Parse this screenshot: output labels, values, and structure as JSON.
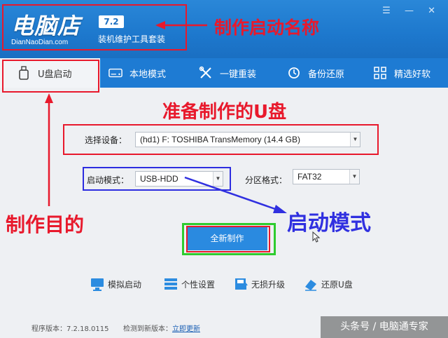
{
  "header": {
    "logo": "电脑店",
    "logo_sub": "DianNaoDian.com",
    "version": "7.2",
    "tagline": "装机维护工具套装",
    "window_controls": [
      "☰",
      "—",
      "✕"
    ]
  },
  "nav": [
    {
      "label": "U盘启动",
      "icon": "usb-icon"
    },
    {
      "label": "本地模式",
      "icon": "hdd-icon"
    },
    {
      "label": "一键重装",
      "icon": "tools-icon"
    },
    {
      "label": "备份还原",
      "icon": "restore-icon"
    },
    {
      "label": "精选好软",
      "icon": "grid-icon"
    }
  ],
  "form": {
    "device_label": "选择设备：",
    "device_value": "(hd1) F: TOSHIBA TransMemory (14.4 GB)",
    "boot_mode_label": "启动模式：",
    "boot_mode_value": "USB-HDD",
    "partition_label": "分区格式：",
    "partition_value": "FAT32",
    "make_button": "全新制作"
  },
  "tools": [
    {
      "label": "模拟启动",
      "icon": "monitor-icon"
    },
    {
      "label": "个性设置",
      "icon": "settings-icon"
    },
    {
      "label": "无损升级",
      "icon": "upgrade-icon"
    },
    {
      "label": "还原U盘",
      "icon": "eraser-icon"
    }
  ],
  "status": {
    "version_text": "程序版本：7.2.18.0115",
    "update_text": "检测到新版本：",
    "update_link": "立即更新"
  },
  "annotations": {
    "name": "制作启动名称",
    "prepare": "准备制作的U盘",
    "purpose": "制作目的",
    "boot_mode": "启动模式"
  },
  "watermark": "头条号 / 电脑通专家",
  "colors": {
    "accent": "#1e7bd3",
    "annotation_red": "#e8192c",
    "annotation_blue": "#2d2de0",
    "annotation_green": "#2ecc2e"
  }
}
